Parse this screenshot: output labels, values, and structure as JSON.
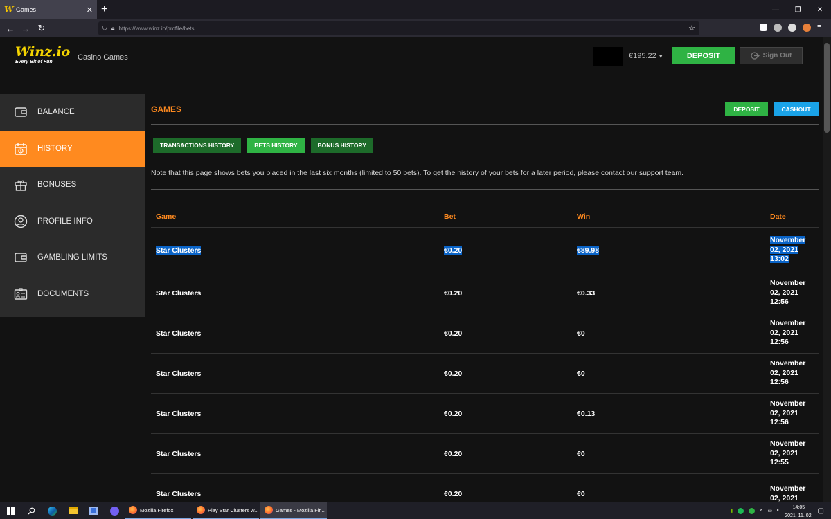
{
  "browser": {
    "tab_title": "Games",
    "tab_favicon": "W",
    "url": "https://www.winz.io/profile/bets"
  },
  "header": {
    "logo": "Winz.io",
    "logo_tagline": "Every Bit of Fun",
    "nav_link": "Casino Games",
    "balance": "€195.22",
    "deposit_label": "DEPOSIT",
    "signout_label": "Sign Out"
  },
  "sidebar": {
    "items": [
      {
        "label": "BALANCE",
        "icon": "wallet-icon",
        "active": false
      },
      {
        "label": "HISTORY",
        "icon": "history-icon",
        "active": true
      },
      {
        "label": "BONUSES",
        "icon": "gift-icon",
        "active": false
      },
      {
        "label": "PROFILE INFO",
        "icon": "user-icon",
        "active": false
      },
      {
        "label": "GAMBLING LIMITS",
        "icon": "wallet-icon",
        "active": false
      },
      {
        "label": "DOCUMENTS",
        "icon": "id-card-icon",
        "active": false
      }
    ]
  },
  "main": {
    "title": "GAMES",
    "deposit_label": "DEPOSIT",
    "cashout_label": "CASHOUT",
    "tabs": [
      {
        "label": "TRANSACTIONS HISTORY",
        "active": false
      },
      {
        "label": "BETS HISTORY",
        "active": true
      },
      {
        "label": "BONUS HISTORY",
        "active": false
      }
    ],
    "note": "Note that this page shows bets you placed in the last six months (limited to 50 bets). To get the history of your bets for a later period, please contact our support team.",
    "columns": {
      "game": "Game",
      "bet": "Bet",
      "win": "Win",
      "date": "Date"
    },
    "rows": [
      {
        "game": "Star Clusters",
        "bet": "€0.20",
        "win": "€89.98",
        "date_1": "November",
        "date_2": "02, 2021",
        "date_3": "13:02",
        "selected": true
      },
      {
        "game": "Star Clusters",
        "bet": "€0.20",
        "win": "€0.33",
        "date_1": "November",
        "date_2": "02, 2021",
        "date_3": "12:56"
      },
      {
        "game": "Star Clusters",
        "bet": "€0.20",
        "win": "€0",
        "date_1": "November",
        "date_2": "02, 2021",
        "date_3": "12:56"
      },
      {
        "game": "Star Clusters",
        "bet": "€0.20",
        "win": "€0",
        "date_1": "November",
        "date_2": "02, 2021",
        "date_3": "12:56"
      },
      {
        "game": "Star Clusters",
        "bet": "€0.20",
        "win": "€0.13",
        "date_1": "November",
        "date_2": "02, 2021",
        "date_3": "12:56"
      },
      {
        "game": "Star Clusters",
        "bet": "€0.20",
        "win": "€0",
        "date_1": "November",
        "date_2": "02, 2021",
        "date_3": "12:55"
      },
      {
        "game": "Star Clusters",
        "bet": "€0.20",
        "win": "€0",
        "date_1": "November",
        "date_2": "02, 2021",
        "date_3": ""
      }
    ]
  },
  "taskbar": {
    "apps": [
      {
        "label": "Mozilla Firefox",
        "active": false
      },
      {
        "label": "Play Star Clusters w...",
        "active": false
      },
      {
        "label": "Games - Mozilla Fir...",
        "active": true
      }
    ],
    "time": "14:05",
    "date": "2021. 11. 02."
  },
  "colors": {
    "accent_orange": "#ff8a1f",
    "green": "#2fb344",
    "dark_green": "#1d6b2a",
    "blue": "#1aa3e8",
    "selection": "#0a64c8",
    "logo_yellow": "#f4d400"
  }
}
